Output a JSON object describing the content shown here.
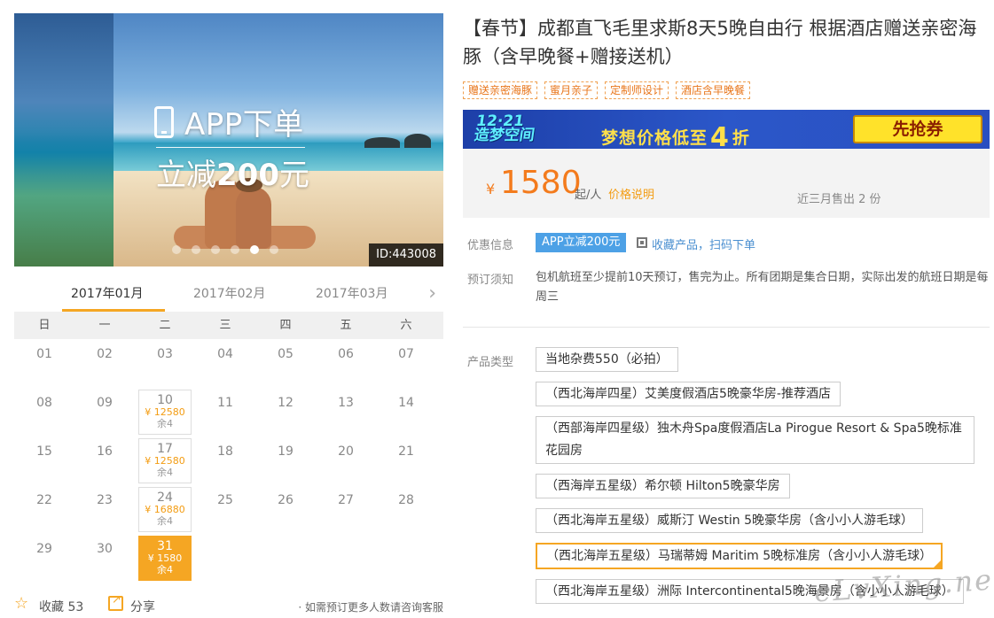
{
  "hero": {
    "promo_line1": "APP下单",
    "promo_line2_prefix": "立减",
    "promo_line2_amount": "200",
    "promo_line2_suffix": "元",
    "id_tag": "ID:443008",
    "carousel_dots": 6,
    "active_dot": 5
  },
  "calendar": {
    "months": [
      "2017年01月",
      "2017年02月",
      "2017年03月"
    ],
    "weekdays": [
      "日",
      "一",
      "二",
      "三",
      "四",
      "五",
      "六"
    ],
    "days": [
      {
        "d": "01"
      },
      {
        "d": "02"
      },
      {
        "d": "03"
      },
      {
        "d": "04"
      },
      {
        "d": "05"
      },
      {
        "d": "06"
      },
      {
        "d": "07"
      },
      {
        "d": "08"
      },
      {
        "d": "09"
      },
      {
        "d": "10",
        "price": "¥ 12580",
        "remain": "余4"
      },
      {
        "d": "11"
      },
      {
        "d": "12"
      },
      {
        "d": "13"
      },
      {
        "d": "14"
      },
      {
        "d": "15"
      },
      {
        "d": "16"
      },
      {
        "d": "17",
        "price": "¥ 12580",
        "remain": "余4"
      },
      {
        "d": "18"
      },
      {
        "d": "19"
      },
      {
        "d": "20"
      },
      {
        "d": "21"
      },
      {
        "d": "22"
      },
      {
        "d": "23"
      },
      {
        "d": "24",
        "price": "¥ 16880",
        "remain": "余4"
      },
      {
        "d": "25"
      },
      {
        "d": "26"
      },
      {
        "d": "27"
      },
      {
        "d": "28"
      },
      {
        "d": "29"
      },
      {
        "d": "30"
      },
      {
        "d": "31",
        "price": "¥ 1580",
        "remain": "余4",
        "selected": true
      }
    ]
  },
  "footer": {
    "fav_label": "收藏 53",
    "share_label": "分享",
    "note": "· 如需预订更多人数请咨询客服"
  },
  "product": {
    "title": "【春节】成都直飞毛里求斯8天5晚自由行 根据酒店赠送亲密海豚（含早晚餐+赠接送机）",
    "tags": [
      "赠送亲密海豚",
      "蜜月亲子",
      "定制师设计",
      "酒店含早晚餐"
    ]
  },
  "banner": {
    "logo_line1": "12·21",
    "logo_line2": "造梦空间",
    "slogan_pre": "梦想价格低至",
    "slogan_num": "4",
    "slogan_post": "折",
    "cta": "先抢券"
  },
  "price": {
    "currency": "¥",
    "amount": "1580",
    "unit": "起/人",
    "explain_link": "价格说明",
    "sold": "近三月售出 2 份"
  },
  "info": {
    "discount_label": "优惠信息",
    "app_badge": "APP立减200元",
    "qr_text": "收藏产品，扫码下单",
    "notice_label": "预订须知",
    "notice_text": "包机航班至少提前10天预订，售完为止。所有团期是集合日期，实际出发的航班日期是每周三",
    "type_label": "产品类型"
  },
  "options": [
    {
      "label": "当地杂费550（必拍）"
    },
    {
      "label": "（西北海岸四星）艾美度假酒店5晚豪华房-推荐酒店"
    },
    {
      "label": "（西部海岸四星级）独木舟Spa度假酒店La Pirogue Resort & Spa5晚标准花园房",
      "wrap": true
    },
    {
      "label": "（西海岸五星级）希尔顿 Hilton5晚豪华房"
    },
    {
      "label": "（西北海岸五星级）威斯汀 Westin 5晚豪华房（含小小人游毛球）"
    },
    {
      "label": "（西北海岸五星级）马瑞蒂姆 Maritim 5晚标准房（含小小人游毛球）",
      "selected": true
    },
    {
      "label": "（西北海岸五星级）洲际 Intercontinental5晚海景房（含小小人游毛球）"
    }
  ],
  "watermark": "eLvXing.net",
  "colors": {
    "accent": "#f5a623",
    "price": "#f37b1d",
    "link": "#4a8fd0",
    "badge": "#4da1e6"
  }
}
